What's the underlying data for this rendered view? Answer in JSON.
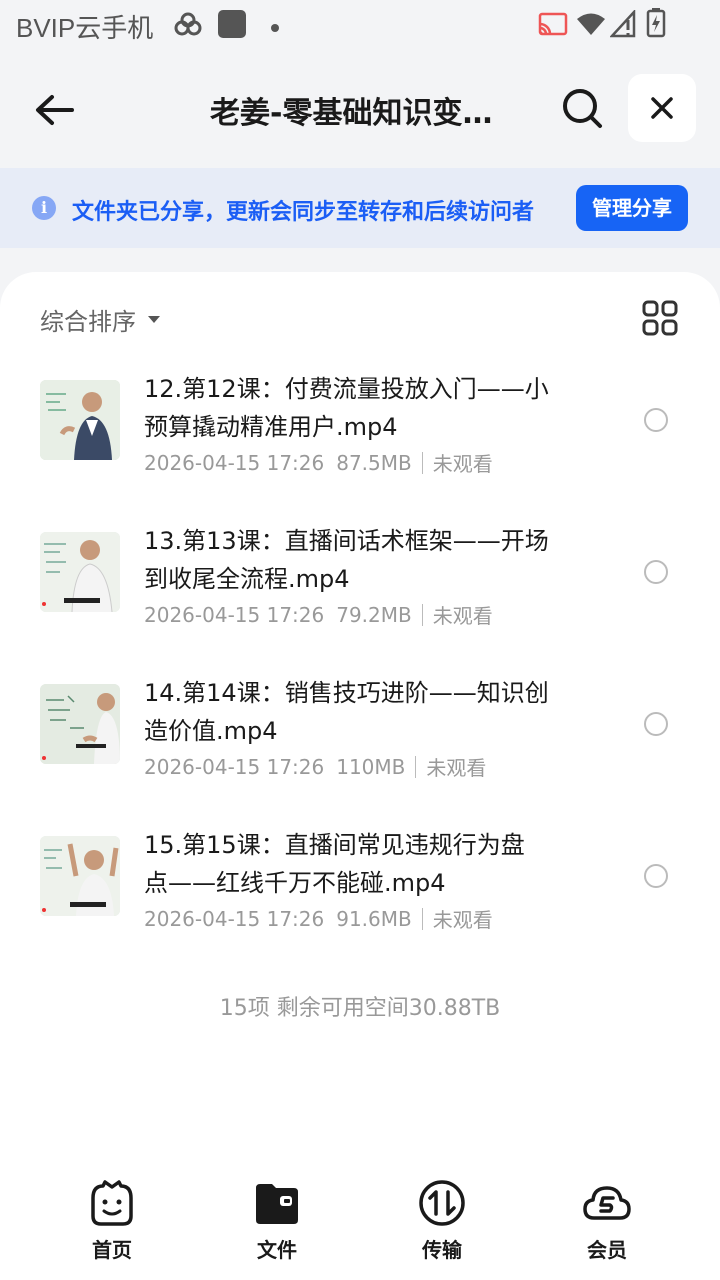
{
  "status_bar": {
    "carrier": "BVIP云手机"
  },
  "header": {
    "title": "老姜-零基础知识变…"
  },
  "banner": {
    "text": "文件夹已分享，更新会同步至转存和后续访问者",
    "manage_label": "管理分享"
  },
  "toolbar": {
    "sort_label": "综合排序"
  },
  "files": [
    {
      "name_line1": "12.第12课：付费流量投放入门——小",
      "name_line2": "预算撬动精准用户.mp4",
      "date": "2026-04-15 17:26",
      "size": "87.5MB",
      "status": "未观看"
    },
    {
      "name_line1": "13.第13课：直播间话术框架——开场",
      "name_line2": "到收尾全流程.mp4",
      "date": "2026-04-15 17:26",
      "size": "79.2MB",
      "status": "未观看"
    },
    {
      "name_line1": "14.第14课：销售技巧进阶——知识创",
      "name_line2": "造价值.mp4",
      "date": "2026-04-15 17:26",
      "size": "110MB",
      "status": "未观看"
    },
    {
      "name_line1": "15.第15课：直播间常见违规行为盘",
      "name_line2": "点——红线千万不能碰.mp4",
      "date": "2026-04-15 17:26",
      "size": "91.6MB",
      "status": "未观看"
    }
  ],
  "footer": {
    "summary": "15项 剩余可用空间30.88TB"
  },
  "bottom_nav": [
    {
      "label": "首页",
      "icon": "smiley-icon"
    },
    {
      "label": "文件",
      "icon": "folder-icon"
    },
    {
      "label": "传输",
      "icon": "transfer-icon"
    },
    {
      "label": "会员",
      "icon": "cloud-vip-icon"
    }
  ],
  "colors": {
    "accent": "#1764f5",
    "banner_bg": "#e7ecf7",
    "banner_text": "#1b5ef5"
  }
}
